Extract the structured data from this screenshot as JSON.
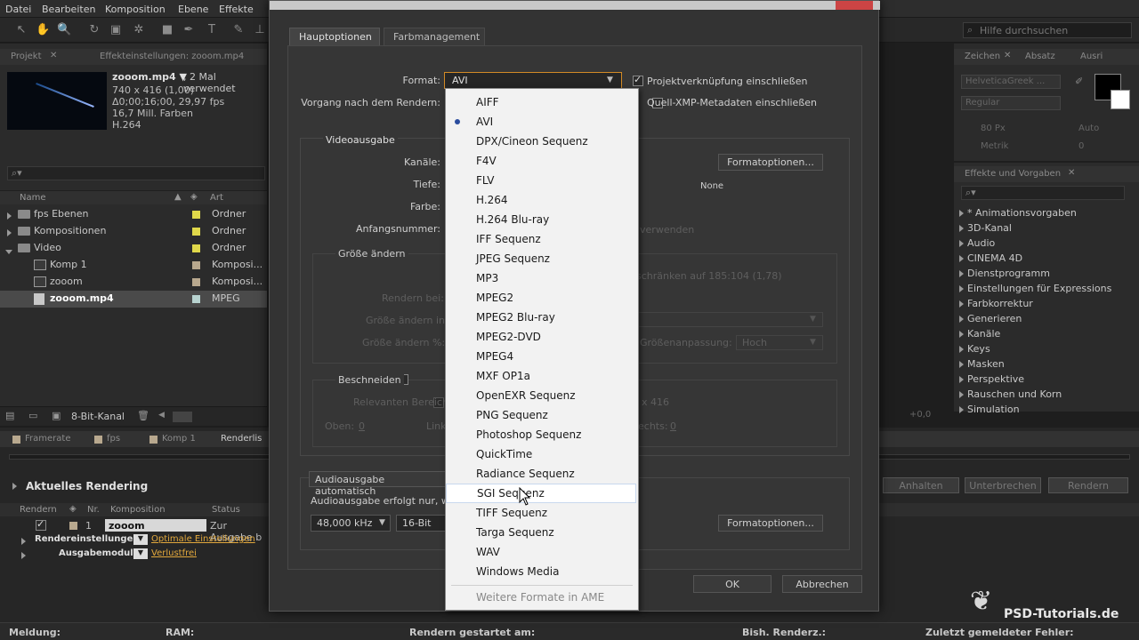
{
  "menubar": [
    "Datei",
    "Bearbeiten",
    "Komposition",
    "Ebene",
    "Effekte"
  ],
  "help_search": "Hilfe durchsuchen",
  "project": {
    "tab": "Projekt",
    "effect_tab": "Effekteinstellungen: zooom.mp4",
    "file_name": "zooom.mp4 ▼",
    "used": ", 2 Mal verwendet",
    "info": [
      "740 x 416 (1,00)",
      "Δ0;00;16;00, 29,97 fps",
      "16,7 Mill. Farben",
      "H.264"
    ],
    "col_name": "Name",
    "col_type": "Art",
    "rows": [
      {
        "name": "fps Ebenen",
        "type": "Ordner",
        "color": "#e0d84a"
      },
      {
        "name": "Kompositionen",
        "type": "Ordner",
        "color": "#e0d84a"
      },
      {
        "name": "Video",
        "type": "Ordner",
        "color": "#e0d84a"
      },
      {
        "name": "Komp 1",
        "type": "Komposi...",
        "color": "#b8a88e"
      },
      {
        "name": "zooom",
        "type": "Komposi...",
        "color": "#b8a88e"
      },
      {
        "name": "zooom.mp4",
        "type": "MPEG",
        "color": "#b7d2cf"
      }
    ],
    "bit_depth": "8-Bit-Kanal"
  },
  "render_queue": {
    "tabs": [
      "Framerate",
      "fps",
      "Komp 1",
      "Renderlis"
    ],
    "current": "Aktuelles Rendering",
    "cols": [
      "Rendern",
      "Nr.",
      "Komposition",
      "Status"
    ],
    "item_nr": "1",
    "item_comp": "zooom",
    "item_status": "Zur Ausgabe b",
    "render_settings_label": "Rendereinstellungen:",
    "render_settings_value": "Optimale Einstellungen",
    "output_module_label": "Ausgabemodul:",
    "output_module_value": "Verlustfrei",
    "buttons": [
      "Anhalten",
      "Unterbrechen",
      "Rendern"
    ]
  },
  "status_bar": {
    "message": "Meldung:",
    "ram": "RAM:",
    "started": "Rendern gestartet am:",
    "elapsed": "Bish. Renderz.:",
    "last_error": "Zuletzt gemeldeter Fehler:"
  },
  "right_panels": {
    "char_tabs": [
      "Zeichen",
      "Absatz",
      "Ausri"
    ],
    "font": "HelveticaGreek ...",
    "style": "Regular",
    "size": "80 Px",
    "leading": "Auto",
    "kerning": "Metrik",
    "tracking": "0",
    "effects_tab": "Effekte und Vorgaben",
    "effects": [
      "* Animationsvorgaben",
      "3D-Kanal",
      "Audio",
      "CINEMA 4D",
      "Dienstprogramm",
      "Einstellungen für Expressions",
      "Farbkorrektur",
      "Generieren",
      "Kanäle",
      "Keys",
      "Masken",
      "Perspektive",
      "Rauschen und Korn",
      "Simulation"
    ],
    "plus_value": "+0,0"
  },
  "dialog": {
    "title": "Einstellungen für Ausgabemodule",
    "tabs": [
      "Hauptoptionen",
      "Farbmanagement"
    ],
    "format_label": "Format:",
    "format_value": "AVI",
    "post_render_label": "Vorgang nach dem Rendern:",
    "include_project_link": "Projektverknüpfung einschließen",
    "include_xmp": "Quell-XMP-Metadaten einschließen",
    "video_output": "Videoausgabe",
    "channels": "Kanäle:",
    "depth": "Tiefe:",
    "color": "Farbe:",
    "start_number": "Anfangsnummer:",
    "format_options": "Formatoptionen...",
    "none": "None",
    "use_suffix": "r verwenden",
    "resize": "Größe ändern",
    "aspect": "schränken auf 185:104 (1,78)",
    "render_at": "Rendern bei:",
    "resize_to": "Größe ändern in:",
    "resize_pct": "Größe ändern %:",
    "resize_quality_label": "Größenanpassung:",
    "resize_quality": "Hoch",
    "crop": "Beschneiden",
    "relevant_area": "Relevanten Bereich v",
    "crop_size": "x 416",
    "top": "Oben:",
    "top_val": "0",
    "left": "Link",
    "right": "echts:",
    "right_val": "0",
    "audio_auto": "Audioausgabe automatisch",
    "audio_note": "Audioausgabe erfolgt nur, we",
    "sample_rate": "48,000 kHz",
    "bit": "16-Bit",
    "audio_format_options": "Formatoptionen...",
    "ok": "OK",
    "cancel": "Abbrechen"
  },
  "format_menu": {
    "items": [
      "AIFF",
      "AVI",
      "DPX/Cineon Sequenz",
      "F4V",
      "FLV",
      "H.264",
      "H.264 Blu-ray",
      "IFF Sequenz",
      "JPEG Sequenz",
      "MP3",
      "MPEG2",
      "MPEG2 Blu-ray",
      "MPEG2-DVD",
      "MPEG4",
      "MXF OP1a",
      "OpenEXR Sequenz",
      "PNG Sequenz",
      "Photoshop Sequenz",
      "QuickTime",
      "Radiance Sequenz",
      "SGI Sequenz",
      "TIFF Sequenz",
      "Targa Sequenz",
      "WAV",
      "Windows Media"
    ],
    "selected": "AVI",
    "hovered": "SGI Sequenz",
    "more": "Weitere Formate in AME"
  },
  "watermark": "PSD-Tutorials.de"
}
